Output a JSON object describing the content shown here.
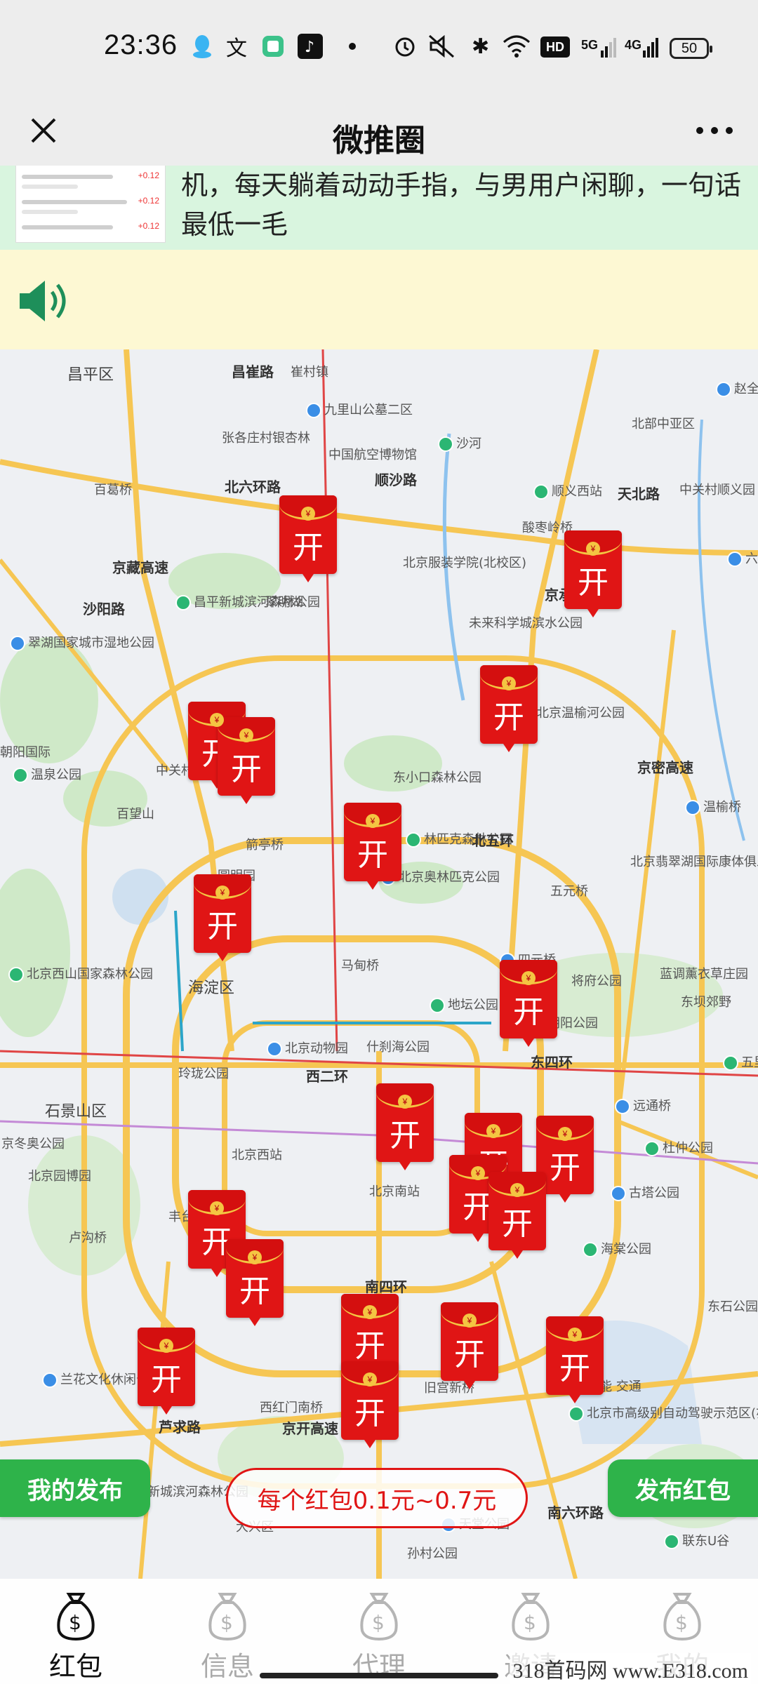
{
  "status": {
    "time": "23:36",
    "battery": "50",
    "network_1": "5G",
    "network_2": "4G",
    "hd_badge": "HD"
  },
  "nav": {
    "title": "微推圈"
  },
  "banner": {
    "text": "机，每天躺着动动手指，与男用户闲聊，一句话最低一毛",
    "thumb_amounts": [
      "+0.12",
      "+0.12",
      "+0.12"
    ]
  },
  "map": {
    "labels": [
      {
        "t": "昌平区",
        "c": "big"
      },
      {
        "t": "昌崔路",
        "c": "road"
      },
      {
        "t": "崔村镇",
        "c": ""
      },
      {
        "t": "九里山公墓二区",
        "c": ""
      },
      {
        "t": "张各庄村银杏林",
        "c": ""
      },
      {
        "t": "中国航空博物馆",
        "c": ""
      },
      {
        "t": "沙河",
        "c": ""
      },
      {
        "t": "顺沙路",
        "c": "road"
      },
      {
        "t": "北部中亚区",
        "c": ""
      },
      {
        "t": "赵全营镇",
        "c": ""
      },
      {
        "t": "百葛桥",
        "c": ""
      },
      {
        "t": "北六环路",
        "c": "road"
      },
      {
        "t": "顺义西站",
        "c": ""
      },
      {
        "t": "酸枣岭桥",
        "c": ""
      },
      {
        "t": "中关村顺义园",
        "c": ""
      },
      {
        "t": "六环",
        "c": ""
      },
      {
        "t": "北京服装学院(北校区)",
        "c": ""
      },
      {
        "t": "沙阳路",
        "c": "road"
      },
      {
        "t": "昌平新城滨河森林公园",
        "c": ""
      },
      {
        "t": "翠明湖",
        "c": ""
      },
      {
        "t": "未来科学城滨水公园",
        "c": ""
      },
      {
        "t": "翠湖国家城市湿地公园",
        "c": ""
      },
      {
        "t": "北京温榆河公园",
        "c": ""
      },
      {
        "t": "朝阳国际",
        "c": ""
      },
      {
        "t": "温泉公园",
        "c": ""
      },
      {
        "t": "中关村",
        "c": ""
      },
      {
        "t": "东小口森林公园",
        "c": ""
      },
      {
        "t": "温榆桥",
        "c": ""
      },
      {
        "t": "百望山",
        "c": ""
      },
      {
        "t": "箭亭桥",
        "c": ""
      },
      {
        "t": "林匹克森林公园",
        "c": ""
      },
      {
        "t": "北五环",
        "c": "road"
      },
      {
        "t": "圆明园",
        "c": ""
      },
      {
        "t": "北京奥林匹克公园",
        "c": ""
      },
      {
        "t": "五元桥",
        "c": ""
      },
      {
        "t": "北京翡翠湖国际康体俱乐部",
        "c": ""
      },
      {
        "t": "北京西山国家森林公园",
        "c": ""
      },
      {
        "t": "海淀区",
        "c": "big"
      },
      {
        "t": "马甸桥",
        "c": ""
      },
      {
        "t": "四元桥",
        "c": ""
      },
      {
        "t": "将府公园",
        "c": ""
      },
      {
        "t": "蓝调薰衣草庄园",
        "c": ""
      },
      {
        "t": "地坛公园",
        "c": ""
      },
      {
        "t": "朝阳公园",
        "c": ""
      },
      {
        "t": "东坝郊野",
        "c": ""
      },
      {
        "t": "北京动物园",
        "c": ""
      },
      {
        "t": "什刹海公园",
        "c": ""
      },
      {
        "t": "玲珑公园",
        "c": ""
      },
      {
        "t": "五里桥",
        "c": ""
      },
      {
        "t": "石景山区",
        "c": "big"
      },
      {
        "t": "西二环",
        "c": "road"
      },
      {
        "t": "远通桥",
        "c": ""
      },
      {
        "t": "京冬奥公园",
        "c": ""
      },
      {
        "t": "北京西站",
        "c": ""
      },
      {
        "t": "杜仲公园",
        "c": ""
      },
      {
        "t": "北京园博园",
        "c": ""
      },
      {
        "t": "北京南站",
        "c": ""
      },
      {
        "t": "古塔公园",
        "c": ""
      },
      {
        "t": "卢沟桥",
        "c": ""
      },
      {
        "t": "丰台",
        "c": ""
      },
      {
        "t": "海棠公园",
        "c": ""
      },
      {
        "t": "南四环",
        "c": "road"
      },
      {
        "t": "东石公园",
        "c": ""
      },
      {
        "t": "兰花文化休闲公园",
        "c": ""
      },
      {
        "t": "西红门南桥",
        "c": ""
      },
      {
        "t": "旧宫新桥",
        "c": ""
      },
      {
        "t": "北京市高级别自动驾驶示范区(亦庄)",
        "c": ""
      },
      {
        "t": "新城滨河森林公园",
        "c": ""
      },
      {
        "t": "大兴区",
        "c": ""
      },
      {
        "t": "天堂公园",
        "c": ""
      },
      {
        "t": "孙村公园",
        "c": ""
      },
      {
        "t": "南六环路",
        "c": "road"
      },
      {
        "t": "联东U谷",
        "c": ""
      },
      {
        "t": "芦求路",
        "c": "road"
      },
      {
        "t": "京开高速",
        "c": "road"
      },
      {
        "t": "京藏高速",
        "c": "road"
      },
      {
        "t": "京承高速",
        "c": "road"
      },
      {
        "t": "东四环",
        "c": "road"
      },
      {
        "t": "京密高速",
        "c": "road"
      },
      {
        "t": "天北路",
        "c": "road"
      },
      {
        "t": "机能 交通",
        "c": ""
      }
    ],
    "packet_label": "开",
    "packet_count": 20
  },
  "buttons": {
    "my_posts": "我的发布",
    "range": "每个红包0.1元~0.7元",
    "publish": "发布红包"
  },
  "tabs": [
    {
      "label": "红包",
      "active": true
    },
    {
      "label": "信息",
      "active": false
    },
    {
      "label": "代理",
      "active": false
    },
    {
      "label": "邀请",
      "active": false
    },
    {
      "label": "我的",
      "active": false
    }
  ],
  "watermark": "318首码网 www.E318.com",
  "colors": {
    "accent_red": "#e01515",
    "accent_green": "#2eb34a",
    "banner_bg": "#d9f5df",
    "notice_bg": "#fdf8d3"
  }
}
